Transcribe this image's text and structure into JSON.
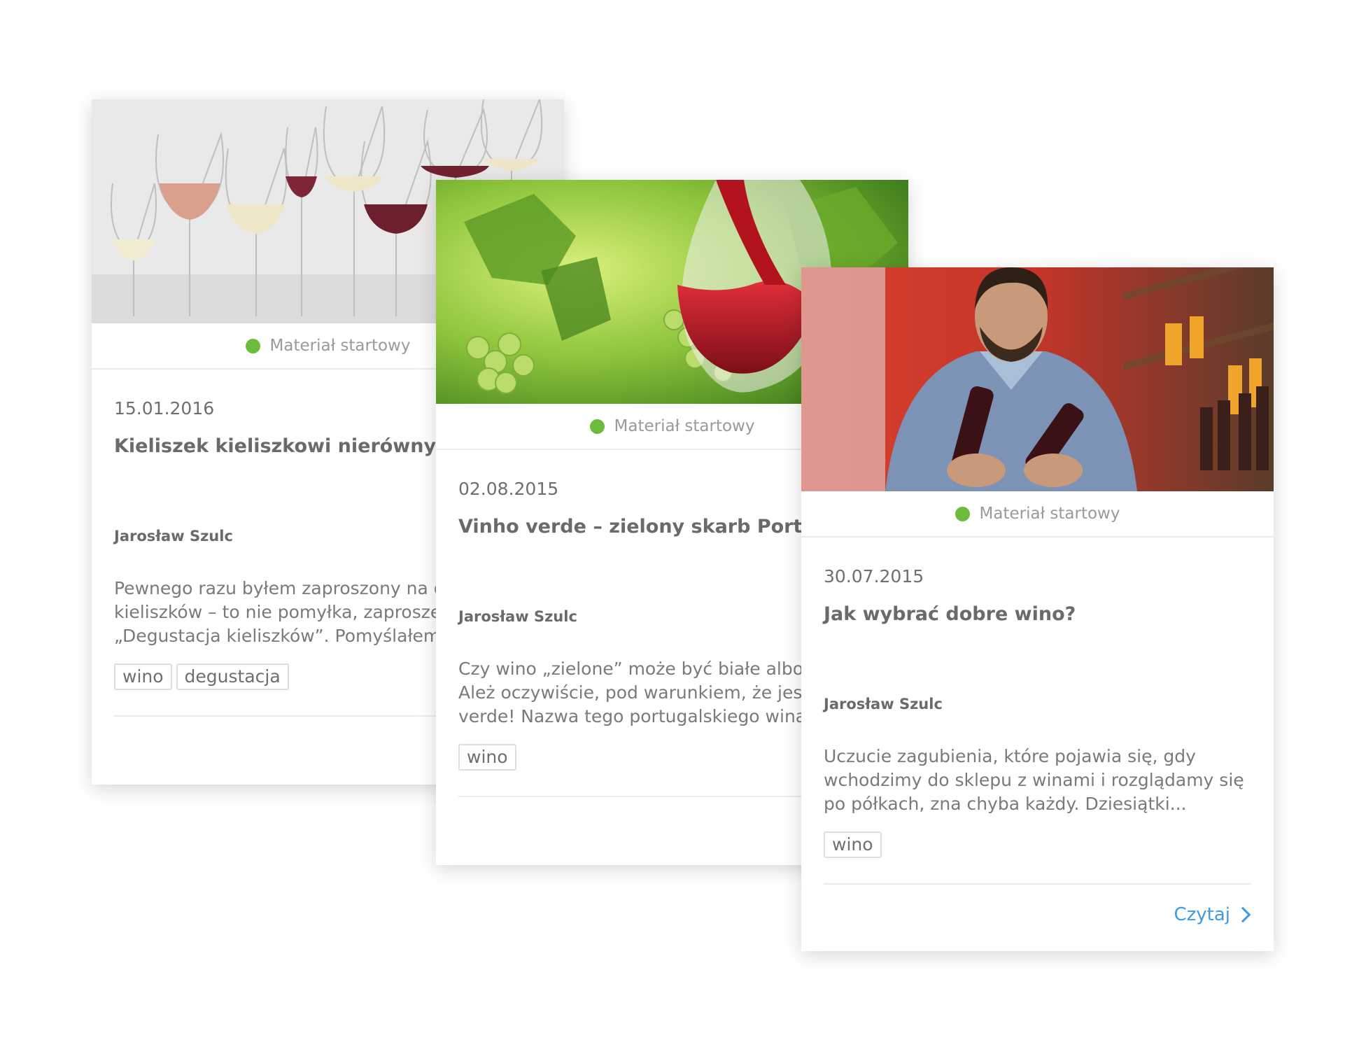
{
  "cards": [
    {
      "status": "Materiał startowy",
      "date": "15.01.2016",
      "title": "Kieliszek kieliszkowi nierówny...",
      "author": "Jarosław Szulc",
      "excerpt_lines": [
        "Pewnego razu byłem zaproszony na d",
        "kieliszków – to nie pomyłka, zaproszer",
        "„Degustacja kieliszków”. Pomyślałem i"
      ],
      "tags": [
        "wino",
        "degustacja"
      ],
      "image": "wine-glasses-photo"
    },
    {
      "status": "Materiał startowy",
      "date": "02.08.2015",
      "title": "Vinho verde – zielony skarb Portuga",
      "author": "Jarosław Szulc",
      "excerpt_lines": [
        "Czy wino „zielone” może być białe albo cz",
        "Ależ oczywiście, pod warunkiem, że jest t",
        "verde! Nazwa tego portugalskiego wina..."
      ],
      "tags": [
        "wino"
      ],
      "image": "red-wine-grapes-photo"
    },
    {
      "status": "Materiał startowy",
      "date": "30.07.2015",
      "title": "Jak wybrać dobre wino?",
      "author": "Jarosław Szulc",
      "excerpt_lines": [
        "Uczucie zagubienia, które pojawia się, gdy",
        "wchodzimy do sklepu z winami i rozglądamy się",
        "po półkach, zna chyba każdy. Dziesiątki..."
      ],
      "tags": [
        "wino"
      ],
      "read_label": "Czytaj",
      "image": "man-choosing-wine-photo"
    }
  ],
  "colors": {
    "status_dot": "#6dbb3c",
    "link": "#3f9be3",
    "text": "#6f6f6f"
  }
}
